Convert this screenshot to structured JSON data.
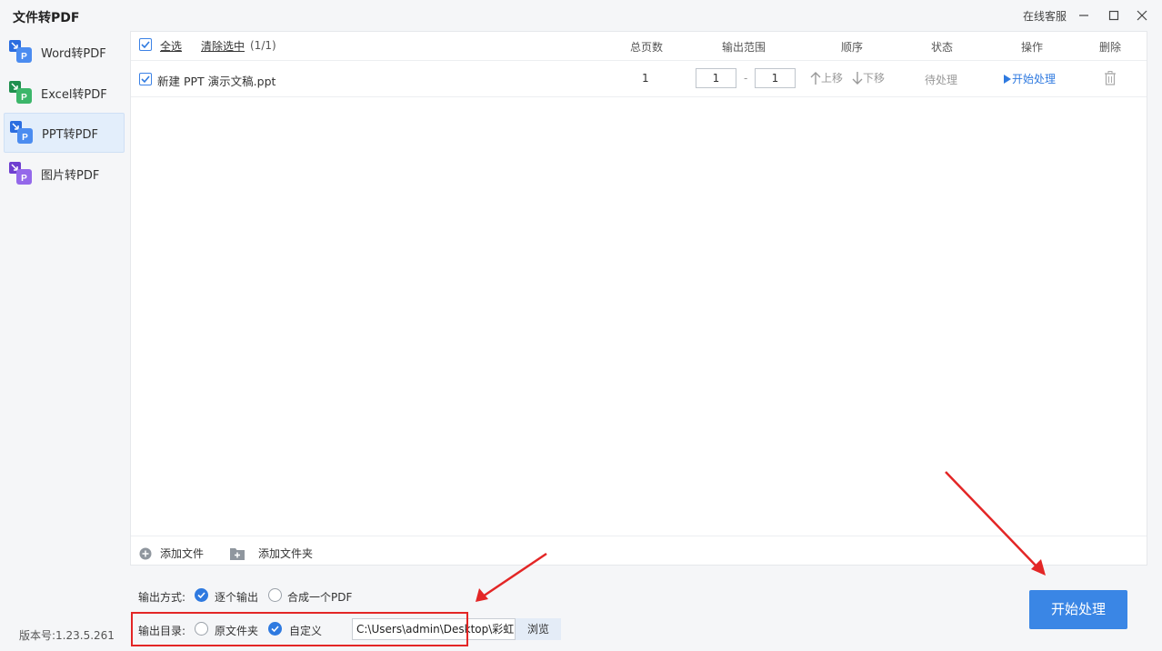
{
  "app": {
    "title": "文件转PDF",
    "support": "在线客服",
    "version": "版本号:1.23.5.261"
  },
  "sidebar": {
    "items": [
      {
        "label": "Word转PDF",
        "color": "#3a7bea"
      },
      {
        "label": "Excel转PDF",
        "color": "#2fa860"
      },
      {
        "label": "PPT转PDF",
        "color": "#3a7bea",
        "active": true
      },
      {
        "label": "图片转PDF",
        "color": "#8a5be0"
      }
    ]
  },
  "table": {
    "select_all": "全选",
    "clear_selection": "清除选中",
    "count": "(1/1)",
    "columns": {
      "total_pages": "总页数",
      "range": "输出范围",
      "order": "顺序",
      "status": "状态",
      "action": "操作",
      "delete": "删除"
    },
    "rows": [
      {
        "filename": "新建 PPT 演示文稿.ppt",
        "pages": "1",
        "range_from": "1",
        "range_sep": "-",
        "range_to": "1",
        "move_up": "上移",
        "move_down": "下移",
        "status": "待处理",
        "action": "开始处理"
      }
    ]
  },
  "footer": {
    "add_file": "添加文件",
    "add_folder": "添加文件夹"
  },
  "options": {
    "output_mode_label": "输出方式:",
    "mode_each": "逐个输出",
    "mode_merge": "合成一个PDF",
    "output_dir_label": "输出目录:",
    "dir_original": "原文件夹",
    "dir_custom": "自定义",
    "path": "C:\\Users\\admin\\Desktop\\彩虹",
    "browse": "浏览"
  },
  "start_button": "开始处理",
  "colors": {
    "accent": "#3a86e5",
    "annotation": "#e32626"
  }
}
